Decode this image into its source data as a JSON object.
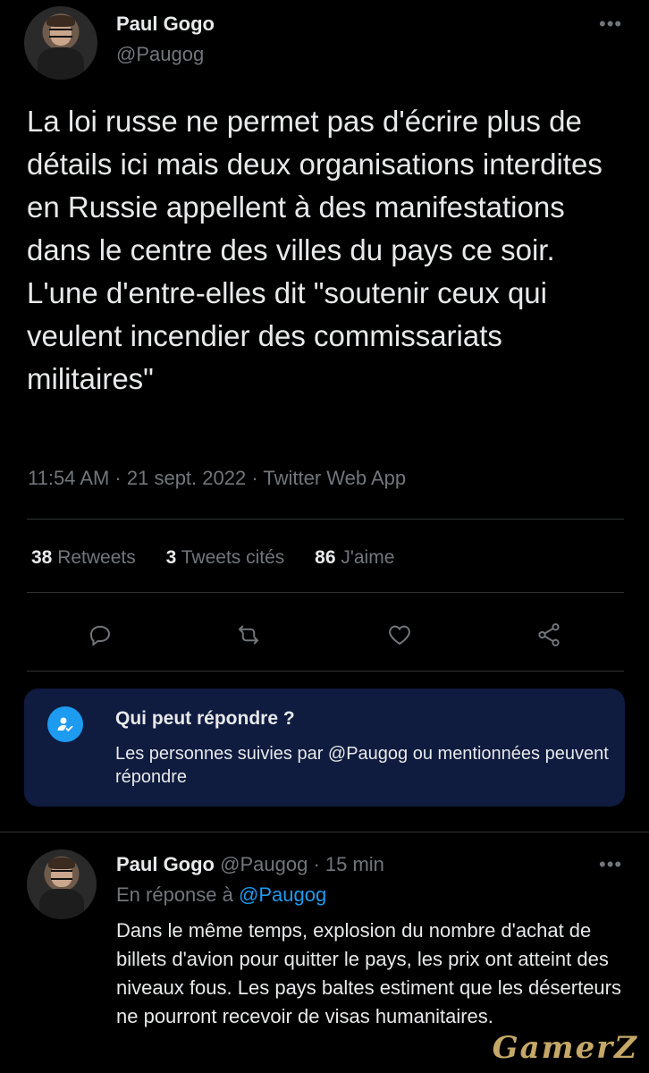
{
  "tweet": {
    "author_name": "Paul Gogo",
    "author_handle": "@Paugog",
    "more_icon": "more-horizontal-icon",
    "text": "La loi russe ne permet pas d'écrire plus de détails ici mais deux organisations interdites en Russie appellent à des manifestations dans le centre des villes du pays ce soir. L'une d'entre-elles dit \"soutenir ceux qui veulent incendier des commissariats militaires\"",
    "meta": "11:54 AM · 21 sept. 2022 · Twitter Web App",
    "stats": [
      {
        "count": "38",
        "label": "Retweets"
      },
      {
        "count": "3",
        "label": "Tweets cités"
      },
      {
        "count": "86",
        "label": "J'aime"
      }
    ],
    "actions": [
      "reply-icon",
      "retweet-icon",
      "like-icon",
      "share-icon"
    ]
  },
  "who_can_reply": {
    "title": "Qui peut répondre ?",
    "description": "Les personnes suivies par @Paugog ou mentionnées peuvent répondre",
    "icon": "user-check-icon"
  },
  "reply": {
    "author_name": "Paul Gogo",
    "author_handle": "@Paugog",
    "time": "· 15 min",
    "in_reply_prefix": "En réponse à",
    "in_reply_handle": "@Paugog",
    "text": "Dans le même temps, explosion du nombre d'achat de billets d'avion pour quitter le pays, les prix ont atteint des niveaux fous. Les pays baltes estiment que les déserteurs ne pourront recevoir de visas humanitaires."
  },
  "watermark": "GamerZ",
  "colors": {
    "background": "#000000",
    "text": "#e7e9ea",
    "muted": "#71767b",
    "accent": "#1d9bf0",
    "reply_box": "#0f1b3f"
  }
}
